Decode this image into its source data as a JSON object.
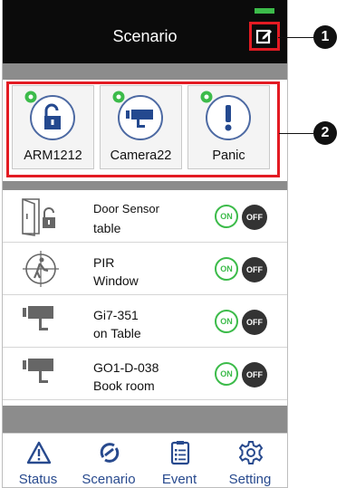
{
  "header": {
    "title": "Scenario"
  },
  "scenarios": [
    {
      "label": "ARM1212",
      "icon": "lock-icon"
    },
    {
      "label": "Camera22",
      "icon": "camera-icon"
    },
    {
      "label": "Panic",
      "icon": "exclamation-icon"
    }
  ],
  "devices": [
    {
      "line1": "Door Sensor",
      "line2": "table",
      "icon": "door-sensor-icon",
      "on": "ON",
      "off": "OFF"
    },
    {
      "line1": "PIR",
      "line2": "Window",
      "icon": "pir-icon",
      "on": "ON",
      "off": "OFF"
    },
    {
      "line1": "Gi7-351",
      "line2": "on Table",
      "icon": "camera-device-icon",
      "on": "ON",
      "off": "OFF"
    },
    {
      "line1": "GO1-D-038",
      "line2": "Book room",
      "icon": "camera-device-icon",
      "on": "ON",
      "off": "OFF"
    }
  ],
  "nav": [
    {
      "label": "Status",
      "icon": "warning-icon"
    },
    {
      "label": "Scenario",
      "icon": "scenario-icon"
    },
    {
      "label": "Event",
      "icon": "list-icon"
    },
    {
      "label": "Setting",
      "icon": "gear-icon"
    }
  ],
  "callouts": [
    "1",
    "2"
  ],
  "colors": {
    "accent": "#284a8e",
    "highlight": "#e31b23",
    "on": "#3cbb4a",
    "off": "#333333",
    "header": "#0b0b0b"
  }
}
